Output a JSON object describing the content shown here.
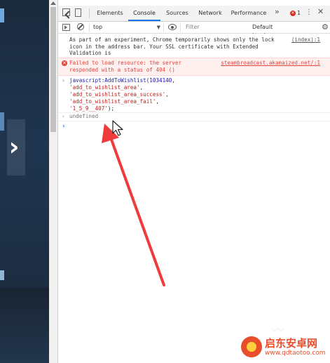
{
  "page": {
    "carousel_arrow": "›"
  },
  "devtools": {
    "tabs": [
      "Elements",
      "Console",
      "Sources",
      "Network",
      "Performance"
    ],
    "active_tab": "Console",
    "more_tabs": "»",
    "error_count": "1",
    "kebab": "⋮",
    "close": "✕"
  },
  "filterbar": {
    "context": "top",
    "filter_placeholder": "Filter",
    "levels": "Default levels"
  },
  "console": {
    "info_message": "As part of an experiment, Chrome temporarily shows only the lock\nicon in the address bar. Your SSL certificate with Extended Validation is\nstill valid.",
    "info_source": "(index):1",
    "error_message": "Failed to load resource: the server\nresponded with a status of 404 ()",
    "error_source": "steambroadcast.akamaized.net/:1",
    "command": {
      "fn": "javascript:AddToWishlist(",
      "num": "1034140",
      "arg1": "'add_to_wishlist_area'",
      "arg2": "'add_to_wishlist_area_success'",
      "arg3": "'add_to_wishlist_area_fail'",
      "arg4": "'1_5_9__407'",
      "close": ");"
    },
    "result": "undefined"
  },
  "watermark": {
    "title": "启东安卓网",
    "url": "www.qdtaotoo.com"
  },
  "colors": {
    "accent": "#1a73e8",
    "error": "#e0443e",
    "arrow": "#ef3b3b"
  }
}
